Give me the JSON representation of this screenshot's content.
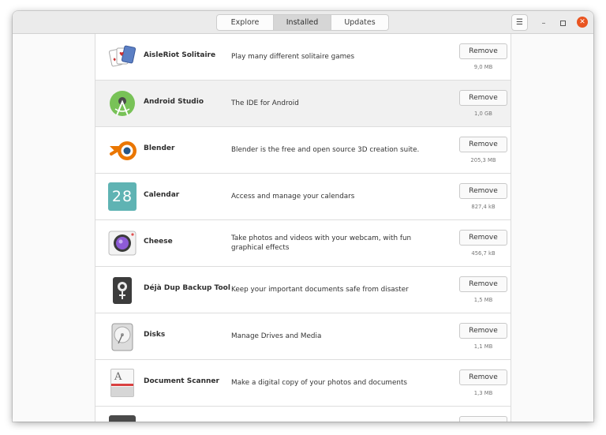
{
  "header": {
    "tabs": [
      {
        "label": "Explore"
      },
      {
        "label": "Installed"
      },
      {
        "label": "Updates"
      }
    ],
    "active_tab": "Installed",
    "menu_icon": "hamburger-icon",
    "window_controls": [
      "minimize-icon",
      "maximize-icon",
      "close-icon"
    ],
    "accent_close": "#e95420"
  },
  "apps": [
    {
      "name": "AisleRiot Solitaire",
      "description": "Play many different solitaire games",
      "remove_label": "Remove",
      "size": "9,0 MB",
      "icon": "solitaire-cards-icon"
    },
    {
      "name": "Android Studio",
      "description": "The IDE for Android",
      "remove_label": "Remove",
      "size": "1,0 GB",
      "icon": "android-studio-icon"
    },
    {
      "name": "Blender",
      "description": "Blender is the free and open source 3D creation suite.",
      "remove_label": "Remove",
      "size": "205,3 MB",
      "icon": "blender-icon"
    },
    {
      "name": "Calendar",
      "description": "Access and manage your calendars",
      "remove_label": "Remove",
      "size": "827,4 kB",
      "icon": "calendar-icon",
      "icon_text": "28"
    },
    {
      "name": "Cheese",
      "description": "Take photos and videos with your webcam, with fun graphical effects",
      "remove_label": "Remove",
      "size": "456,7 kB",
      "icon": "cheese-webcam-icon"
    },
    {
      "name": "Déjà Dup Backup Tool",
      "description": "Keep your important documents safe from disaster",
      "remove_label": "Remove",
      "size": "1,5 MB",
      "icon": "backup-safe-icon"
    },
    {
      "name": "Disks",
      "description": "Manage Drives and Media",
      "remove_label": "Remove",
      "size": "1,1 MB",
      "icon": "disk-drive-icon"
    },
    {
      "name": "Document Scanner",
      "description": "Make a digital copy of your photos and documents",
      "remove_label": "Remove",
      "size": "1,3 MB",
      "icon": "document-scanner-icon",
      "icon_text": "A"
    }
  ]
}
